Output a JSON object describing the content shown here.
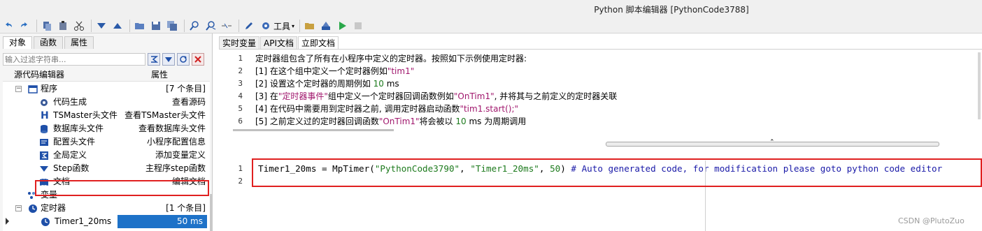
{
  "window": {
    "title": "Python 脚本编辑器 [PythonCode3788]"
  },
  "toolbar": {
    "tools_label": "工具"
  },
  "left_tabs": [
    "对象",
    "函数",
    "属性"
  ],
  "filter": {
    "placeholder": "输入过滤字符串..."
  },
  "tree": {
    "header_name": "源代码编辑器",
    "header_prop": "属性",
    "program": {
      "label": "程序",
      "count": "[7 个条目]"
    },
    "items": [
      {
        "label": "代码生成",
        "value": "查看源码",
        "icon": "gear-icon"
      },
      {
        "label": "TSMaster头文件",
        "value": "查看TSMaster头文件",
        "icon": "h-icon"
      },
      {
        "label": "数据库头文件",
        "value": "查看数据库头文件",
        "icon": "database-icon"
      },
      {
        "label": "配置头文件",
        "value": "小程序配置信息",
        "icon": "config-icon"
      },
      {
        "label": "全局定义",
        "value": "添加变量定义",
        "icon": "global-icon"
      },
      {
        "label": "Step函数",
        "value": "主程序step函数",
        "icon": "triangle-icon"
      },
      {
        "label": "文档",
        "value": "编辑文档",
        "icon": "book-icon"
      }
    ],
    "variables": {
      "label": "变量"
    },
    "timers": {
      "label": "定时器",
      "count": "[1 个条目]"
    },
    "timer_item": {
      "label": "Timer1_20ms",
      "value": "50 ms"
    }
  },
  "doc_tabs": [
    "实时变量",
    "API文档",
    "立即文档"
  ],
  "doc_lines": [
    {
      "num": "1",
      "text": "定时器组包含了所有在小程序中定义的定时器。按照如下示例使用定时器:"
    },
    {
      "num": "2",
      "parts": [
        "[1] 在这个组中定义一个定时器例如",
        "\"tim1\"",
        ""
      ]
    },
    {
      "num": "3",
      "parts": [
        "[2] 设置这个定时器的周期例如 ",
        "10",
        " ms"
      ]
    },
    {
      "num": "4",
      "parts": [
        "[3] 在",
        "\"定时器事件\"",
        "组中定义一个定时器回调函数例如",
        "\"OnTim1\"",
        ", 并将其与之前定义的定时器关联"
      ]
    },
    {
      "num": "5",
      "parts": [
        "[4] 在代码中需要用到定时器之前, 调用定时器启动函数",
        "\"tim1.start();\"",
        ""
      ]
    },
    {
      "num": "6",
      "parts": [
        "[5] 之前定义过的定时器回调函数",
        "\"OnTim1\"",
        "将会被以 ",
        "10",
        " ms 为周期调用"
      ]
    }
  ],
  "code_lines": [
    {
      "num": "1",
      "pre": "Timer1_20ms = MpTimer(",
      "s1": "\"PythonCode3790\"",
      "mid1": ", ",
      "s2": "\"Timer1_20ms\"",
      "mid2": ", ",
      "n": "50",
      "post": ") ",
      "comment": "# Auto generated code, for modification please goto python code editor"
    },
    {
      "num": "2"
    }
  ],
  "watermark": "CSDN @PlutoZuo",
  "colors": {
    "accent": "#1e72c8",
    "highlight": "#e02020"
  }
}
